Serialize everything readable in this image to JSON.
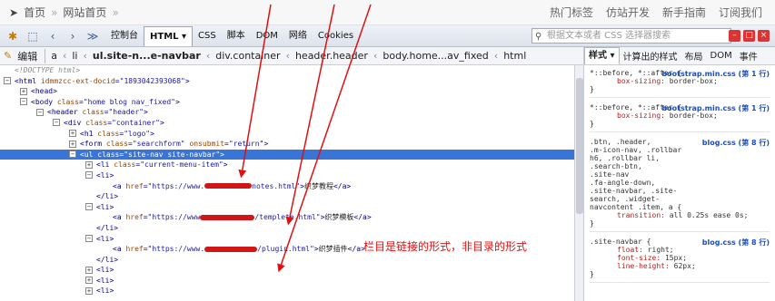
{
  "topbar": {
    "home": "首页",
    "sep": "»",
    "site_home": "网站首页",
    "nav": [
      "热门标签",
      "仿站开发",
      "新手指南",
      "订阅我们"
    ]
  },
  "toolbar": {
    "tabs": [
      "控制台",
      "HTML ▾",
      "CSS",
      "脚本",
      "DOM",
      "网络",
      "Cookies"
    ],
    "search_placeholder": "根据文本或者 CSS 选择器搜索"
  },
  "breadcrumb": {
    "edit": "编辑",
    "items": [
      "a",
      "li",
      "ul.site-n...e-navbar",
      "div.container",
      "header.header",
      "body.home...av_fixed",
      "html"
    ]
  },
  "right_tabs": [
    "样式 ▾",
    "计算出的样式",
    "布局",
    "DOM",
    "事件"
  ],
  "tree": [
    {
      "indent": 0,
      "pm": "",
      "parts": [
        [
          "cmt",
          "<!DOCTYPE html>"
        ]
      ]
    },
    {
      "indent": 0,
      "pm": "−",
      "parts": [
        [
          "tg",
          "<html "
        ],
        [
          "at",
          "idmmzcc-ext-docid"
        ],
        [
          "tg",
          "="
        ],
        [
          "av",
          "\"1893042393068\""
        ],
        [
          "tg",
          ">"
        ]
      ]
    },
    {
      "indent": 1,
      "pm": "+",
      "parts": [
        [
          "tg",
          "<head>"
        ]
      ]
    },
    {
      "indent": 1,
      "pm": "−",
      "parts": [
        [
          "tg",
          "<body "
        ],
        [
          "at",
          "class"
        ],
        [
          "tg",
          "="
        ],
        [
          "av",
          "\"home blog nav_fixed\""
        ],
        [
          "tg",
          ">"
        ]
      ]
    },
    {
      "indent": 2,
      "pm": "−",
      "parts": [
        [
          "tg",
          "<header "
        ],
        [
          "at",
          "class"
        ],
        [
          "tg",
          "="
        ],
        [
          "av",
          "\"header\""
        ],
        [
          "tg",
          ">"
        ]
      ]
    },
    {
      "indent": 3,
      "pm": "−",
      "parts": [
        [
          "tg",
          "<div "
        ],
        [
          "at",
          "class"
        ],
        [
          "tg",
          "="
        ],
        [
          "av",
          "\"container\""
        ],
        [
          "tg",
          ">"
        ]
      ]
    },
    {
      "indent": 4,
      "pm": "+",
      "parts": [
        [
          "tg",
          "<h1 "
        ],
        [
          "at",
          "class"
        ],
        [
          "tg",
          "="
        ],
        [
          "av",
          "\"logo\""
        ],
        [
          "tg",
          ">"
        ]
      ]
    },
    {
      "indent": 4,
      "pm": "+",
      "parts": [
        [
          "tg",
          "<form "
        ],
        [
          "at",
          "class"
        ],
        [
          "tg",
          "="
        ],
        [
          "av",
          "\"searchform\""
        ],
        [
          "tg",
          " "
        ],
        [
          "at",
          "onsubmit"
        ],
        [
          "tg",
          "="
        ],
        [
          "av",
          "\"return"
        ],
        [
          "tg",
          "\">"
        ]
      ]
    },
    {
      "indent": 4,
      "pm": "−",
      "hl": true,
      "parts": [
        [
          "tg",
          "<ul "
        ],
        [
          "at",
          "class"
        ],
        [
          "tg",
          "="
        ],
        [
          "av",
          "\"site-nav site-navbar\""
        ],
        [
          "tg",
          ">"
        ]
      ]
    },
    {
      "indent": 5,
      "pm": "+",
      "parts": [
        [
          "tg",
          "<li "
        ],
        [
          "at",
          "class"
        ],
        [
          "tg",
          "="
        ],
        [
          "av",
          "\"current-menu-item\""
        ],
        [
          "tg",
          ">"
        ]
      ]
    },
    {
      "indent": 5,
      "pm": "−",
      "parts": [
        [
          "tg",
          "<li>"
        ]
      ]
    },
    {
      "indent": 6,
      "pm": "",
      "redact": 52,
      "parts": [
        [
          "tg",
          "<a "
        ],
        [
          "at",
          "href"
        ],
        [
          "tg",
          "="
        ],
        [
          "av",
          "\"https://www."
        ],
        [
          "red",
          ""
        ],
        [
          "av",
          "notes.html\""
        ],
        [
          "tg",
          ">"
        ],
        [
          "txt",
          "织梦教程"
        ],
        [
          "tg",
          "</a>"
        ]
      ]
    },
    {
      "indent": 5,
      "pm": "",
      "parts": [
        [
          "tg",
          "</li>"
        ]
      ]
    },
    {
      "indent": 5,
      "pm": "−",
      "parts": [
        [
          "tg",
          "<li>"
        ]
      ]
    },
    {
      "indent": 6,
      "pm": "",
      "redact": 60,
      "parts": [
        [
          "tg",
          "<a "
        ],
        [
          "at",
          "href"
        ],
        [
          "tg",
          "="
        ],
        [
          "av",
          "\"https://www"
        ],
        [
          "red",
          ""
        ],
        [
          "av",
          "/templete.html\""
        ],
        [
          "tg",
          ">"
        ],
        [
          "txt",
          "织梦模板"
        ],
        [
          "tg",
          "</a>"
        ]
      ]
    },
    {
      "indent": 5,
      "pm": "",
      "parts": [
        [
          "tg",
          "</li>"
        ]
      ]
    },
    {
      "indent": 5,
      "pm": "−",
      "parts": [
        [
          "tg",
          "<li>"
        ]
      ]
    },
    {
      "indent": 6,
      "pm": "",
      "redact": 58,
      "parts": [
        [
          "tg",
          "<a "
        ],
        [
          "at",
          "href"
        ],
        [
          "tg",
          "="
        ],
        [
          "av",
          "\"https://www."
        ],
        [
          "red",
          ""
        ],
        [
          "av",
          "/plugin.html\""
        ],
        [
          "tg",
          ">"
        ],
        [
          "txt",
          "织梦插件"
        ],
        [
          "tg",
          "</a>"
        ]
      ]
    },
    {
      "indent": 5,
      "pm": "",
      "parts": [
        [
          "tg",
          "</li>"
        ]
      ]
    },
    {
      "indent": 5,
      "pm": "+",
      "parts": [
        [
          "tg",
          "<li>"
        ]
      ]
    },
    {
      "indent": 5,
      "pm": "+",
      "parts": [
        [
          "tg",
          "<li>"
        ]
      ]
    },
    {
      "indent": 5,
      "pm": "+",
      "parts": [
        [
          "tg",
          "<li>"
        ]
      ]
    }
  ],
  "annotation": "栏目是链接的形式，非目录的形式",
  "css_rules": [
    {
      "selector": "*::before, *::after {",
      "src": "bootstrap.min.css (第 1 行)",
      "decls": [
        [
          "box-sizing",
          "border-box;"
        ]
      ]
    },
    {
      "selector": "*::before, *::after {",
      "src": "bootstrap.min.css (第 1 行)",
      "decls": [
        [
          "box-sizing",
          "border-box;"
        ]
      ]
    },
    {
      "selector": ".btn, .header,\n.m-icon-nav, .rollbar\nh6, .rollbar li,\n.search-btn,\n.site-nav\n.fa-angle-down,\n.site-navbar, .site-\nsearch, .widget-\nnavcontent .item, a {",
      "src": "blog.css (第 8 行)",
      "decls": [
        [
          "transition",
          "all 0.25s ease 0s;"
        ]
      ]
    },
    {
      "selector": ".site-navbar {",
      "src": "blog.css (第 8 行)",
      "decls": [
        [
          "float",
          "right;"
        ],
        [
          "font-size",
          "15px;"
        ],
        [
          "line-height",
          "62px;"
        ]
      ]
    }
  ]
}
